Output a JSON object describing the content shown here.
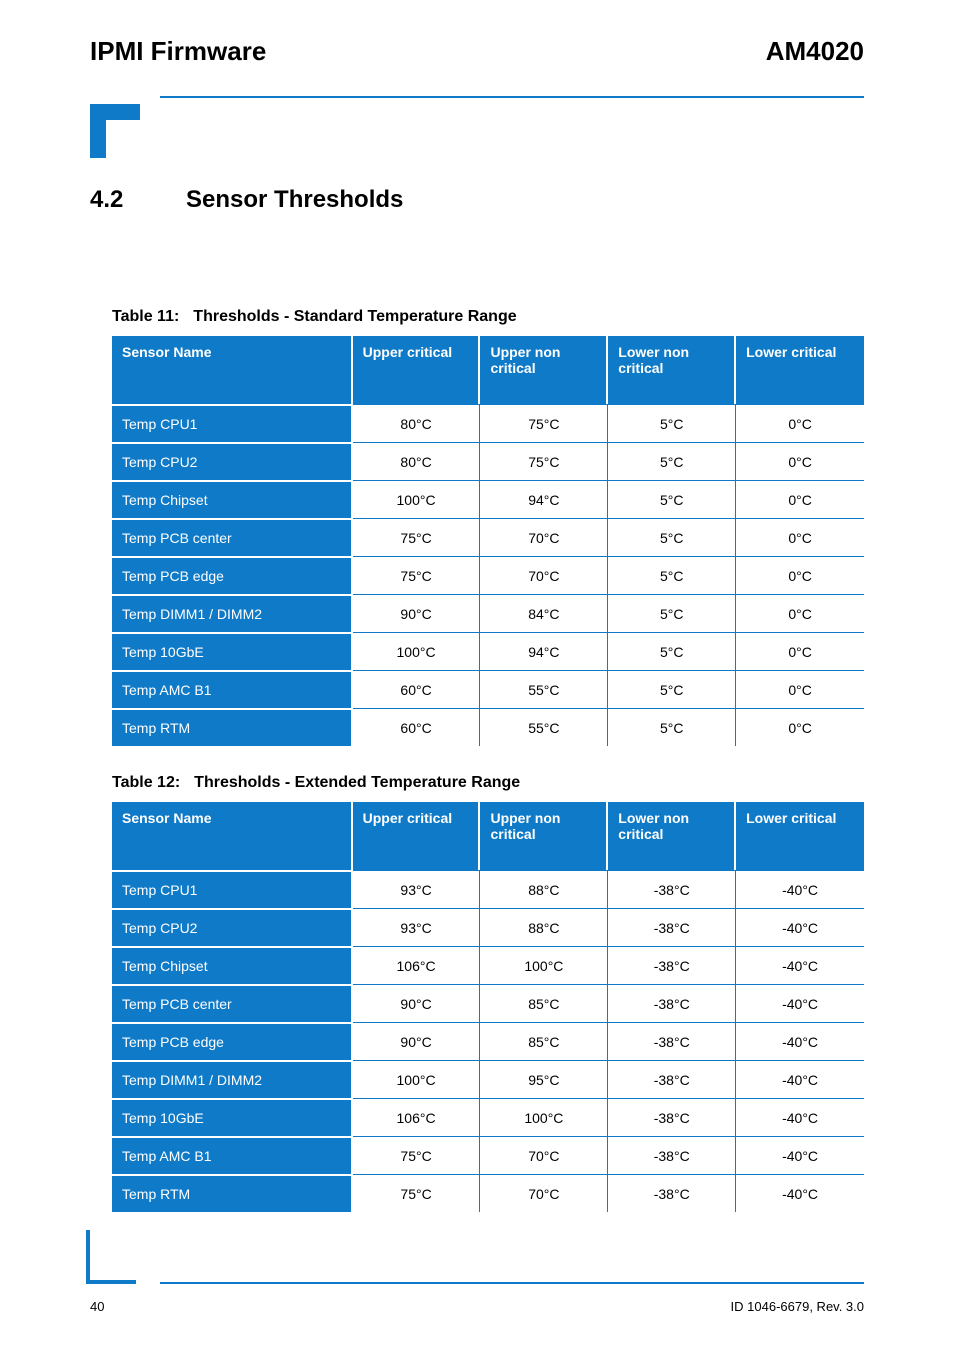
{
  "header": {
    "left": "IPMI Firmware",
    "right": "AM4020"
  },
  "section": {
    "number": "4.2",
    "title": "Sensor Thresholds"
  },
  "columns": {
    "name": "Sensor Name",
    "uc": "Upper\ncritical",
    "uw": "Upper non\ncritical",
    "lw": "Lower non\ncritical",
    "lc": "Lower\ncritical"
  },
  "table1": {
    "caption_prefix": "Table 11:",
    "caption_title": "Thresholds - Standard Temperature Range",
    "rows": [
      {
        "name": "Temp CPU1",
        "uc": "80°C",
        "uw": "75°C",
        "lw": "5°C",
        "lc": "0°C"
      },
      {
        "name": "Temp CPU2",
        "uc": "80°C",
        "uw": "75°C",
        "lw": "5°C",
        "lc": "0°C"
      },
      {
        "name": "Temp Chipset",
        "uc": "100°C",
        "uw": "94°C",
        "lw": "5°C",
        "lc": "0°C"
      },
      {
        "name": "Temp PCB center",
        "uc": "75°C",
        "uw": "70°C",
        "lw": "5°C",
        "lc": "0°C"
      },
      {
        "name": "Temp PCB edge",
        "uc": "75°C",
        "uw": "70°C",
        "lw": "5°C",
        "lc": "0°C"
      },
      {
        "name": "Temp DIMM1 / DIMM2",
        "uc": "90°C",
        "uw": "84°C",
        "lw": "5°C",
        "lc": "0°C"
      },
      {
        "name": "Temp 10GbE",
        "uc": "100°C",
        "uw": "94°C",
        "lw": "5°C",
        "lc": "0°C"
      },
      {
        "name": "Temp AMC B1",
        "uc": "60°C",
        "uw": "55°C",
        "lw": "5°C",
        "lc": "0°C"
      },
      {
        "name": "Temp RTM",
        "uc": "60°C",
        "uw": "55°C",
        "lw": "5°C",
        "lc": "0°C"
      }
    ]
  },
  "table2": {
    "caption_prefix": "Table 12:",
    "caption_title": "Thresholds - Extended Temperature Range",
    "rows": [
      {
        "name": "Temp CPU1",
        "uc": "93°C",
        "uw": "88°C",
        "lw": "-38°C",
        "lc": "-40°C"
      },
      {
        "name": "Temp CPU2",
        "uc": "93°C",
        "uw": "88°C",
        "lw": "-38°C",
        "lc": "-40°C"
      },
      {
        "name": "Temp Chipset",
        "uc": "106°C",
        "uw": "100°C",
        "lw": "-38°C",
        "lc": "-40°C"
      },
      {
        "name": "Temp PCB center",
        "uc": "90°C",
        "uw": "85°C",
        "lw": "-38°C",
        "lc": "-40°C"
      },
      {
        "name": "Temp PCB edge",
        "uc": "90°C",
        "uw": "85°C",
        "lw": "-38°C",
        "lc": "-40°C"
      },
      {
        "name": "Temp DIMM1 / DIMM2",
        "uc": "100°C",
        "uw": "95°C",
        "lw": "-38°C",
        "lc": "-40°C"
      },
      {
        "name": "Temp 10GbE",
        "uc": "106°C",
        "uw": "100°C",
        "lw": "-38°C",
        "lc": "-40°C"
      },
      {
        "name": "Temp AMC B1",
        "uc": "75°C",
        "uw": "70°C",
        "lw": "-38°C",
        "lc": "-40°C"
      },
      {
        "name": "Temp RTM",
        "uc": "75°C",
        "uw": "70°C",
        "lw": "-38°C",
        "lc": "-40°C"
      }
    ]
  },
  "footer": {
    "page": "40",
    "doc_id": "ID 1046-6679, Rev. 3.0"
  },
  "chart_data": [
    {
      "type": "table",
      "title": "Thresholds - Standard Temperature Range",
      "columns": [
        "Sensor Name",
        "Upper critical",
        "Upper non critical",
        "Lower non critical",
        "Lower critical"
      ],
      "rows": [
        [
          "Temp CPU1",
          "80°C",
          "75°C",
          "5°C",
          "0°C"
        ],
        [
          "Temp CPU2",
          "80°C",
          "75°C",
          "5°C",
          "0°C"
        ],
        [
          "Temp Chipset",
          "100°C",
          "94°C",
          "5°C",
          "0°C"
        ],
        [
          "Temp PCB center",
          "75°C",
          "70°C",
          "5°C",
          "0°C"
        ],
        [
          "Temp PCB edge",
          "75°C",
          "70°C",
          "5°C",
          "0°C"
        ],
        [
          "Temp DIMM1 / DIMM2",
          "90°C",
          "84°C",
          "5°C",
          "0°C"
        ],
        [
          "Temp 10GbE",
          "100°C",
          "94°C",
          "5°C",
          "0°C"
        ],
        [
          "Temp AMC B1",
          "60°C",
          "55°C",
          "5°C",
          "0°C"
        ],
        [
          "Temp RTM",
          "60°C",
          "55°C",
          "5°C",
          "0°C"
        ]
      ]
    },
    {
      "type": "table",
      "title": "Thresholds - Extended Temperature Range",
      "columns": [
        "Sensor Name",
        "Upper critical",
        "Upper non critical",
        "Lower non critical",
        "Lower critical"
      ],
      "rows": [
        [
          "Temp CPU1",
          "93°C",
          "88°C",
          "-38°C",
          "-40°C"
        ],
        [
          "Temp CPU2",
          "93°C",
          "88°C",
          "-38°C",
          "-40°C"
        ],
        [
          "Temp Chipset",
          "106°C",
          "100°C",
          "-38°C",
          "-40°C"
        ],
        [
          "Temp PCB center",
          "90°C",
          "85°C",
          "-38°C",
          "-40°C"
        ],
        [
          "Temp PCB edge",
          "90°C",
          "85°C",
          "-38°C",
          "-40°C"
        ],
        [
          "Temp DIMM1 / DIMM2",
          "100°C",
          "95°C",
          "-38°C",
          "-40°C"
        ],
        [
          "Temp 10GbE",
          "106°C",
          "100°C",
          "-38°C",
          "-40°C"
        ],
        [
          "Temp AMC B1",
          "75°C",
          "70°C",
          "-38°C",
          "-40°C"
        ],
        [
          "Temp RTM",
          "75°C",
          "70°C",
          "-38°C",
          "-40°C"
        ]
      ]
    }
  ]
}
